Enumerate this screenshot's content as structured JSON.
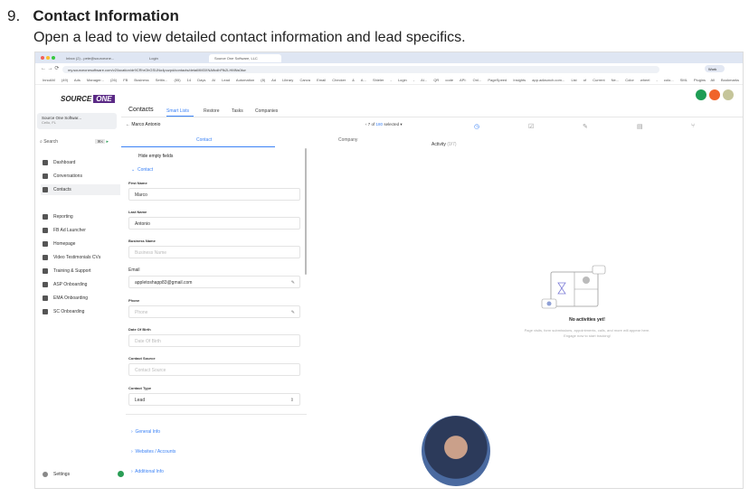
{
  "step": {
    "number": "9.",
    "title": "Contact Information",
    "description": "Open a lead to view detailed contact information and lead specifics."
  },
  "browser": {
    "tabs": [
      "Inbox (2) - pete@sourceone...",
      "Login",
      "Source One Software, LLC"
    ],
    "url": "my.sourceonesoftware.com/v2/location/dr9CRhrOhGSUNo4puzpd/contacts/detail/tM3XNAifcdhFfk2LHMNs0kw",
    "bookmarks": [
      "InnoAM",
      "(49) Ads Manager...",
      "(26) FB Business Settin...",
      "(55) 14 Days",
      "AI Lead Automation",
      "(8) Ad Library",
      "Canva",
      "Email Checker & A...",
      "Shieler - Login - AI...",
      "QR code API: Onl...",
      "PageSpeed Insights",
      "app.adlaunch.com...",
      "List of Current Ne...",
      "Color wheel - colo...",
      "SML Plugins",
      "All Bookmarks"
    ],
    "profile": "Work"
  },
  "app": {
    "logo": "SOURCE ONE",
    "account": {
      "name": "Source One Softwar...",
      "location": "Cello, FL"
    },
    "search": "Search",
    "search_shortcut": "⌘K",
    "nav": [
      "Dashboard",
      "Conversations",
      "Contacts",
      "Reporting",
      "FB Ad Launcher",
      "Homepage",
      "Video Testimonials CVs",
      "Training & Support",
      "ASP Onboarding",
      "EMA Onboarding",
      "SC Onboarding"
    ],
    "settings": "Settings",
    "header": {
      "title": "Contacts",
      "tabs": [
        "Smart Lists",
        "Restore",
        "Tasks",
        "Companies"
      ]
    },
    "contact_name": "Marco Antonio",
    "pager": "7 of",
    "pager_total": "180",
    "pager_selected": "selected",
    "panel_tabs": [
      "Contact",
      "Company"
    ],
    "hide_empty": "Hide empty fields",
    "section": "Contact",
    "fields": [
      {
        "label": "First Name",
        "value": "Marco",
        "placeholder": ""
      },
      {
        "label": "Last Name",
        "value": "Antonio",
        "placeholder": ""
      },
      {
        "label": "Business Name",
        "value": "",
        "placeholder": "Business Name"
      },
      {
        "label": "Email",
        "value": "appletoshapp83@gmail.com",
        "placeholder": ""
      },
      {
        "label": "Phone",
        "value": "",
        "placeholder": "Phone"
      },
      {
        "label": "Date Of Birth",
        "value": "",
        "placeholder": "Date Of Birth"
      },
      {
        "label": "Contact Source",
        "value": "",
        "placeholder": "Contact Source"
      },
      {
        "label": "Contact Type",
        "value": "Lead",
        "placeholder": ""
      }
    ],
    "collapsed_sections": [
      "General Info",
      "Websites / Accounts",
      "Additional Info"
    ],
    "activity": {
      "title": "Activity",
      "count": "(0/7)",
      "empty_title": "No activities yet!",
      "empty_text": "Page visits, form submissions, appointments, calls, and more will appear here. Engage now to start tracking!"
    },
    "action_colors": {
      "call": "#1f9d55",
      "notify": "#f0642a",
      "extra": "#c5c59a"
    }
  }
}
